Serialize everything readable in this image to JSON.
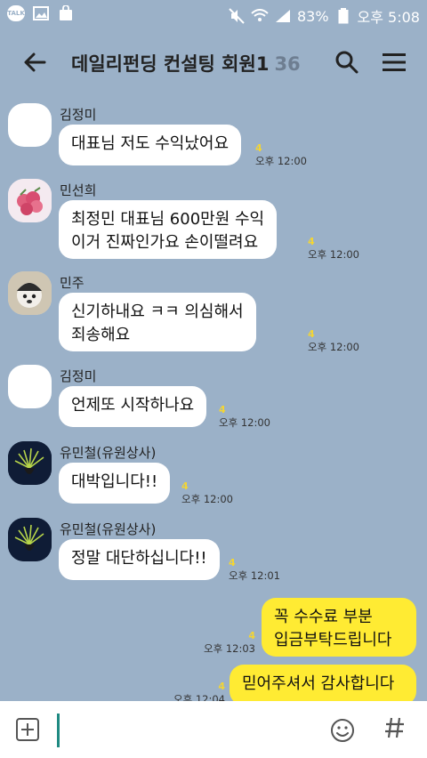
{
  "status_bar": {
    "app_badge": "TALK",
    "battery": "83%",
    "time": "오후 5:08"
  },
  "header": {
    "title": "데일리펀딩 컨설팅 회원1",
    "member_count": "36"
  },
  "messages": [
    {
      "sender": "김정미",
      "text": "대표님 저도 수익났어요",
      "unread": "4",
      "time": "오후 12:00"
    },
    {
      "sender": "민선희",
      "text": "최정민 대표님 600만원 수익\n이거 진짜인가요 손이떨려요",
      "unread": "4",
      "time": "오후 12:00"
    },
    {
      "sender": "민주",
      "text": "신기하내요 ㅋㅋ 의심해서\n죄송해요",
      "unread": "4",
      "time": "오후 12:00"
    },
    {
      "sender": "김정미",
      "text": "언제또 시작하나요",
      "unread": "4",
      "time": "오후 12:00"
    },
    {
      "sender": "유민철(유원상사)",
      "text": "대박입니다!!",
      "unread": "4",
      "time": "오후 12:00"
    },
    {
      "sender": "유민철(유원상사)",
      "text": "정말 대단하십니다!!",
      "unread": "4",
      "time": "오후 12:01"
    },
    {
      "sender": "",
      "text": "꼭 수수료 부분\n입금부탁드립니다",
      "unread": "4",
      "time": "오후 12:03"
    },
    {
      "sender": "",
      "text": "믿어주셔서 감사합니다",
      "unread": "4",
      "time": "오후 12:04"
    }
  ],
  "input": {
    "placeholder": ""
  },
  "colors": {
    "chat_background": "#9bb1c8",
    "outgoing_bubble": "#ffeb33",
    "incoming_bubble": "#ffffff",
    "unread_count": "#f3d534"
  },
  "icons": {
    "back": "arrow-left-icon",
    "search": "search-icon",
    "menu": "hamburger-menu-icon",
    "attach": "plus-icon",
    "emoji": "emoji-icon",
    "hashtag": "hashtag-icon"
  }
}
